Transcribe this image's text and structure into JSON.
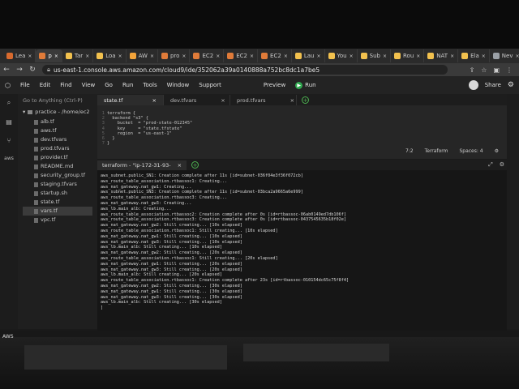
{
  "browser": {
    "tabs": [
      {
        "label": "Lea",
        "color": "#d86a2e"
      },
      {
        "label": "p",
        "color": "#e07b39",
        "active": true
      },
      {
        "label": "Tar",
        "color": "#f2c14e"
      },
      {
        "label": "Loa",
        "color": "#f2c14e"
      },
      {
        "label": "AW",
        "color": "#f2a33a"
      },
      {
        "label": "pro",
        "color": "#e07b39"
      },
      {
        "label": "EC2",
        "color": "#e07b39"
      },
      {
        "label": "EC2",
        "color": "#e07b39"
      },
      {
        "label": "EC2",
        "color": "#e07b39"
      },
      {
        "label": "Lau",
        "color": "#f2c14e"
      },
      {
        "label": "You",
        "color": "#f2c14e"
      },
      {
        "label": "Sub",
        "color": "#f2c14e"
      },
      {
        "label": "Rou",
        "color": "#f2c14e"
      },
      {
        "label": "NAT",
        "color": "#f2c14e"
      },
      {
        "label": "Ela",
        "color": "#f2c14e"
      },
      {
        "label": "Nev",
        "color": "#9aa0a6"
      }
    ],
    "url": "us-east-1.console.aws.amazon.com/cloud9/ide/352062a39a0140888a752bc8dc1a7be5"
  },
  "menu": {
    "items": [
      "File",
      "Edit",
      "Find",
      "View",
      "Go",
      "Run",
      "Tools",
      "Window",
      "Support"
    ],
    "preview_label": "Preview",
    "run_label": "Run",
    "share_label": "Share"
  },
  "sidebar": {
    "goto_label": "Go to Anything (Ctrl-P)",
    "root_label": "practice - /home/ec2",
    "files": [
      "alb.tf",
      "aws.tf",
      "dev.tfvars",
      "prod.tfvars",
      "provider.tf",
      "README.md",
      "security_group.tf",
      "staging.tfvars",
      "startup.sh",
      "state.tf",
      "vars.tf",
      "vpc.tf"
    ],
    "selected": "vars.tf"
  },
  "editor": {
    "tabs": [
      "state.tf",
      "dev.tfvars",
      "prod.tfvars"
    ],
    "active_tab": "state.tf",
    "code_lines": [
      "terraform {",
      "  backend \"s3\" {",
      "    bucket  = \"prod-state-012345\"",
      "    key     = \"state.tfstate\"",
      "    region  = \"us-east-1\"",
      "  }",
      "}"
    ],
    "cursor_pos": "7:2",
    "language": "Terraform",
    "spaces": "Spaces: 4"
  },
  "terminal": {
    "tab_label": "terraform - \"ip-172-31-93-",
    "lines": [
      "aws_subnet.public_SN1: Creation complete after 11s [id=subnet-036f04e3f36f072cb]",
      "aws_route_table_association.rtbassoc1: Creating...",
      "aws_nat_gateway.nat_gw1: Creating...",
      "aws_subnet.public_SN3: Creation complete after 11s [id=subnet-03bca2a9665a6e999]",
      "aws_route_table_association.rtbassoc3: Creating...",
      "aws_nat_gateway.nat_gw3: Creating...",
      "aws_lb.main_alb: Creating...",
      "aws_route_table_association.rtbassoc2: Creation complete after 0s [id=rtbassoc-06ab0149ed7db106f]",
      "aws_route_table_association.rtbassoc3: Creation complete after 0s [id=rtbassoc-0437545635b18f02e]",
      "aws_nat_gateway.nat_gw2: Still creating... [10s elapsed]",
      "aws_route_table_association.rtbassoc1: Still creating... [10s elapsed]",
      "aws_nat_gateway.nat_gw1: Still creating... [10s elapsed]",
      "aws_nat_gateway.nat_gw3: Still creating... [10s elapsed]",
      "aws_lb.main_alb: Still creating... [10s elapsed]",
      "aws_nat_gateway.nat_gw2: Still creating... [20s elapsed]",
      "aws_route_table_association.rtbassoc1: Still creating... [20s elapsed]",
      "aws_nat_gateway.nat_gw1: Still creating... [20s elapsed]",
      "aws_nat_gateway.nat_gw3: Still creating... [20s elapsed]",
      "aws_lb.main_alb: Still creating... [20s elapsed]",
      "aws_route_table_association.rtbassoc1: Creation complete after 23s [id=rtbassoc-010154dc65c75f8f4]",
      "aws_nat_gateway.nat_gw2: Still creating... [30s elapsed]",
      "aws_nat_gateway.nat_gw1: Still creating... [30s elapsed]",
      "aws_nat_gateway.nat_gw3: Still creating... [30s elapsed]",
      "aws_lb.main_alb: Still creating... [30s elapsed]",
      "]"
    ]
  },
  "footer": {
    "aws_label": "AWS"
  }
}
